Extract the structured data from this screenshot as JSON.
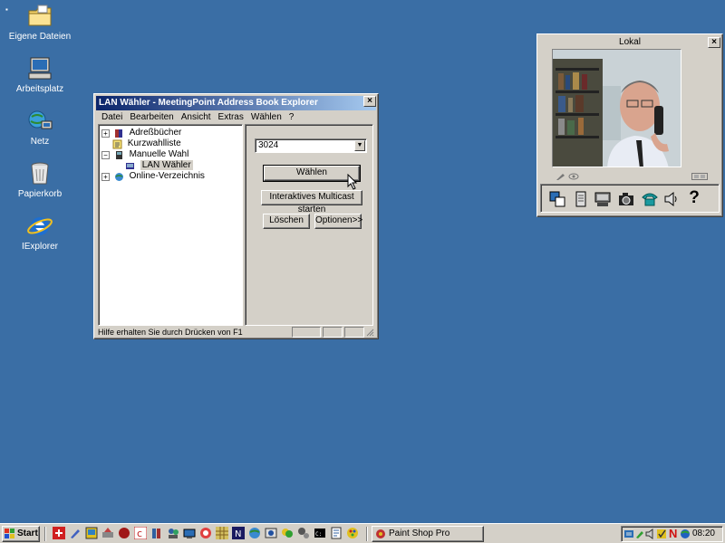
{
  "desktop": {
    "icons": [
      {
        "label": "Eigene Dateien"
      },
      {
        "label": "Arbeitsplatz"
      },
      {
        "label": "Netz"
      },
      {
        "label": "Papierkorb"
      },
      {
        "label": "IExplorer"
      }
    ]
  },
  "main_window": {
    "title": "LAN Wähler - MeetingPoint Address Book Explorer",
    "close": "×",
    "menu": [
      "Datei",
      "Bearbeiten",
      "Ansicht",
      "Extras",
      "Wählen",
      "?"
    ],
    "tree": [
      {
        "label": "Adreßbücher",
        "expander": "+"
      },
      {
        "label": "Kurzwahlliste",
        "expander": ""
      },
      {
        "label": "Manuelle Wahl",
        "expander": "−"
      },
      {
        "label": "LAN Wähler",
        "expander": ""
      },
      {
        "label": "Online-Verzeichnis",
        "expander": "+"
      }
    ],
    "address_value": "3024",
    "buttons": {
      "dial": "Wählen",
      "multicast": "Interaktives Multicast starten",
      "delete": "Löschen",
      "options": "Optionen>>"
    },
    "status_text": "Hilfe erhalten Sie durch Drücken von F1"
  },
  "video_window": {
    "title": "Lokal",
    "close": "×",
    "toolbar_icons": [
      "address-book-icon",
      "list-icon",
      "conference-icon",
      "camera-icon",
      "phone-icon",
      "speaker-icon",
      "help-icon"
    ],
    "help_glyph": "?"
  },
  "taskbar": {
    "start_label": "Start",
    "task_label": "Paint Shop Pro",
    "tray_letter": "N",
    "clock": "08:20"
  }
}
